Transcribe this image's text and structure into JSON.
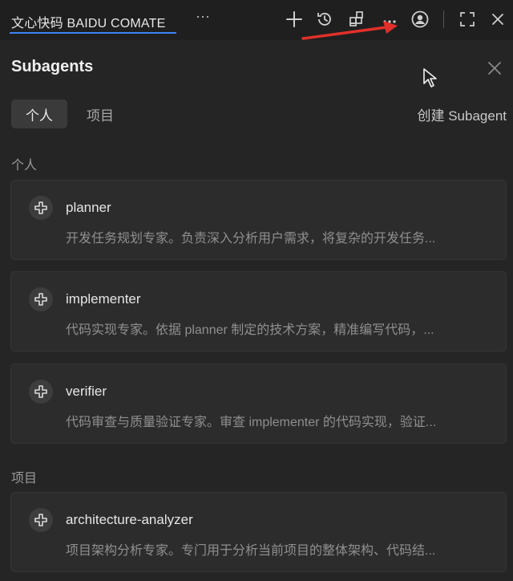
{
  "titlebar": {
    "app_tab_label": "文心快码 BAIDU COMATE",
    "more_label": "···",
    "icons": [
      "add-icon",
      "history-icon",
      "extensions-icon",
      "more-icon",
      "account-icon",
      "fullscreen-icon",
      "close-icon"
    ]
  },
  "panel": {
    "title": "Subagents",
    "tabs": [
      {
        "label": "个人",
        "active": true
      },
      {
        "label": "项目",
        "active": false
      }
    ],
    "create_label": "创建 Subagent",
    "sections": [
      {
        "label": "个人",
        "agents": [
          {
            "name": "planner",
            "description": "开发任务规划专家。负责深入分析用户需求，将复杂的开发任务..."
          },
          {
            "name": "implementer",
            "description": "代码实现专家。依据 planner 制定的技术方案，精准编写代码，..."
          },
          {
            "name": "verifier",
            "description": "代码审查与质量验证专家。审查 implementer 的代码实现，验证..."
          }
        ]
      },
      {
        "label": "项目",
        "agents": [
          {
            "name": "architecture-analyzer",
            "description": "项目架构分析专家。专门用于分析当前项目的整体架构、代码结..."
          }
        ]
      }
    ]
  },
  "colors": {
    "tab_underline": "#3b82f6",
    "annotation_arrow": "#e0302a"
  }
}
